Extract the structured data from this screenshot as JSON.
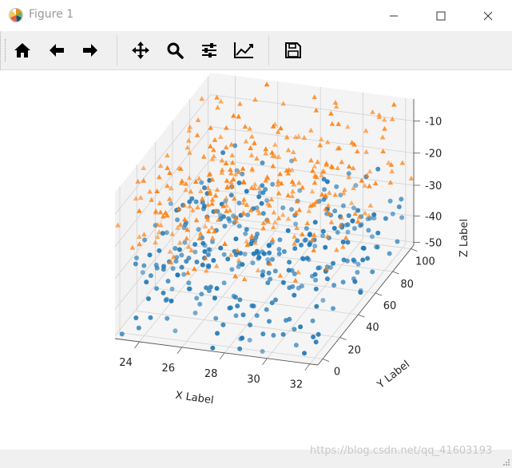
{
  "window": {
    "title": "Figure 1",
    "minimize_icon": "minimize-icon",
    "maximize_icon": "maximize-icon",
    "close_icon": "close-icon"
  },
  "toolbar": {
    "items": [
      {
        "name": "home-button",
        "icon": "home-icon"
      },
      {
        "name": "back-button",
        "icon": "arrow-left-icon"
      },
      {
        "name": "forward-button",
        "icon": "arrow-right-icon"
      },
      {
        "name": "pan-button",
        "icon": "move-icon"
      },
      {
        "name": "zoom-button",
        "icon": "magnifier-icon"
      },
      {
        "name": "subplots-button",
        "icon": "sliders-icon"
      },
      {
        "name": "axes-button",
        "icon": "line-chart-icon"
      },
      {
        "name": "save-button",
        "icon": "floppy-icon"
      }
    ]
  },
  "watermark": "https://blog.csdn.net/qq_41603193",
  "chart_data": {
    "type": "scatter",
    "projection": "3d",
    "xlabel": "X Label",
    "ylabel": "Y Label",
    "zlabel": "Z Label",
    "x_ticks": [
      "24",
      "26",
      "28",
      "30",
      "32"
    ],
    "y_ticks": [
      "0",
      "20",
      "40",
      "60",
      "80",
      "100"
    ],
    "z_ticks": [
      "-10",
      "-20",
      "-30",
      "-40",
      "-50"
    ],
    "xlim": [
      23,
      32
    ],
    "ylim": [
      0,
      100
    ],
    "zlim": [
      -50,
      -5
    ],
    "series": [
      {
        "marker": "o",
        "color": "#1f77b4",
        "x_range": [
          23,
          32
        ],
        "y_range": [
          0,
          100
        ],
        "z_range": [
          -50,
          -25
        ]
      },
      {
        "marker": "^",
        "color": "#ff7f0e",
        "x_range": [
          23,
          32
        ],
        "y_range": [
          0,
          100
        ],
        "z_range": [
          -30,
          -5
        ]
      }
    ]
  }
}
